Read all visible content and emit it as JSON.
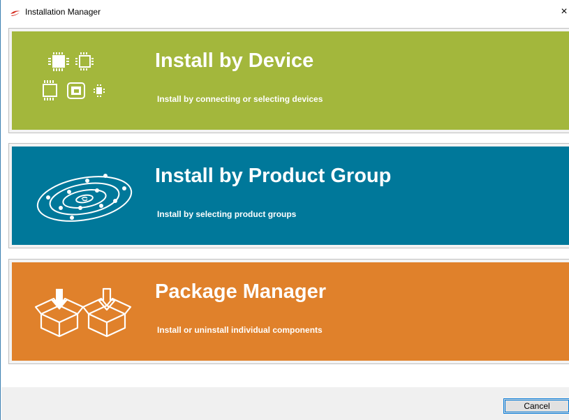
{
  "window": {
    "title": "Installation Manager",
    "close_glyph": "×",
    "icon": "silicon-labs-logo-icon"
  },
  "cards": [
    {
      "heading": "Install by Device",
      "subtitle": "Install by connecting or selecting devices",
      "color": "#a3b73c",
      "icon": "device-chips-icon"
    },
    {
      "heading": "Install by Product Group",
      "subtitle": "Install by selecting product groups",
      "color": "#00789a",
      "icon": "orbit-rings-icon"
    },
    {
      "heading": "Package Manager",
      "subtitle": "Install or uninstall individual components",
      "color": "#e0812b",
      "icon": "package-boxes-icon"
    }
  ],
  "footer": {
    "cancel_label": "Cancel"
  }
}
